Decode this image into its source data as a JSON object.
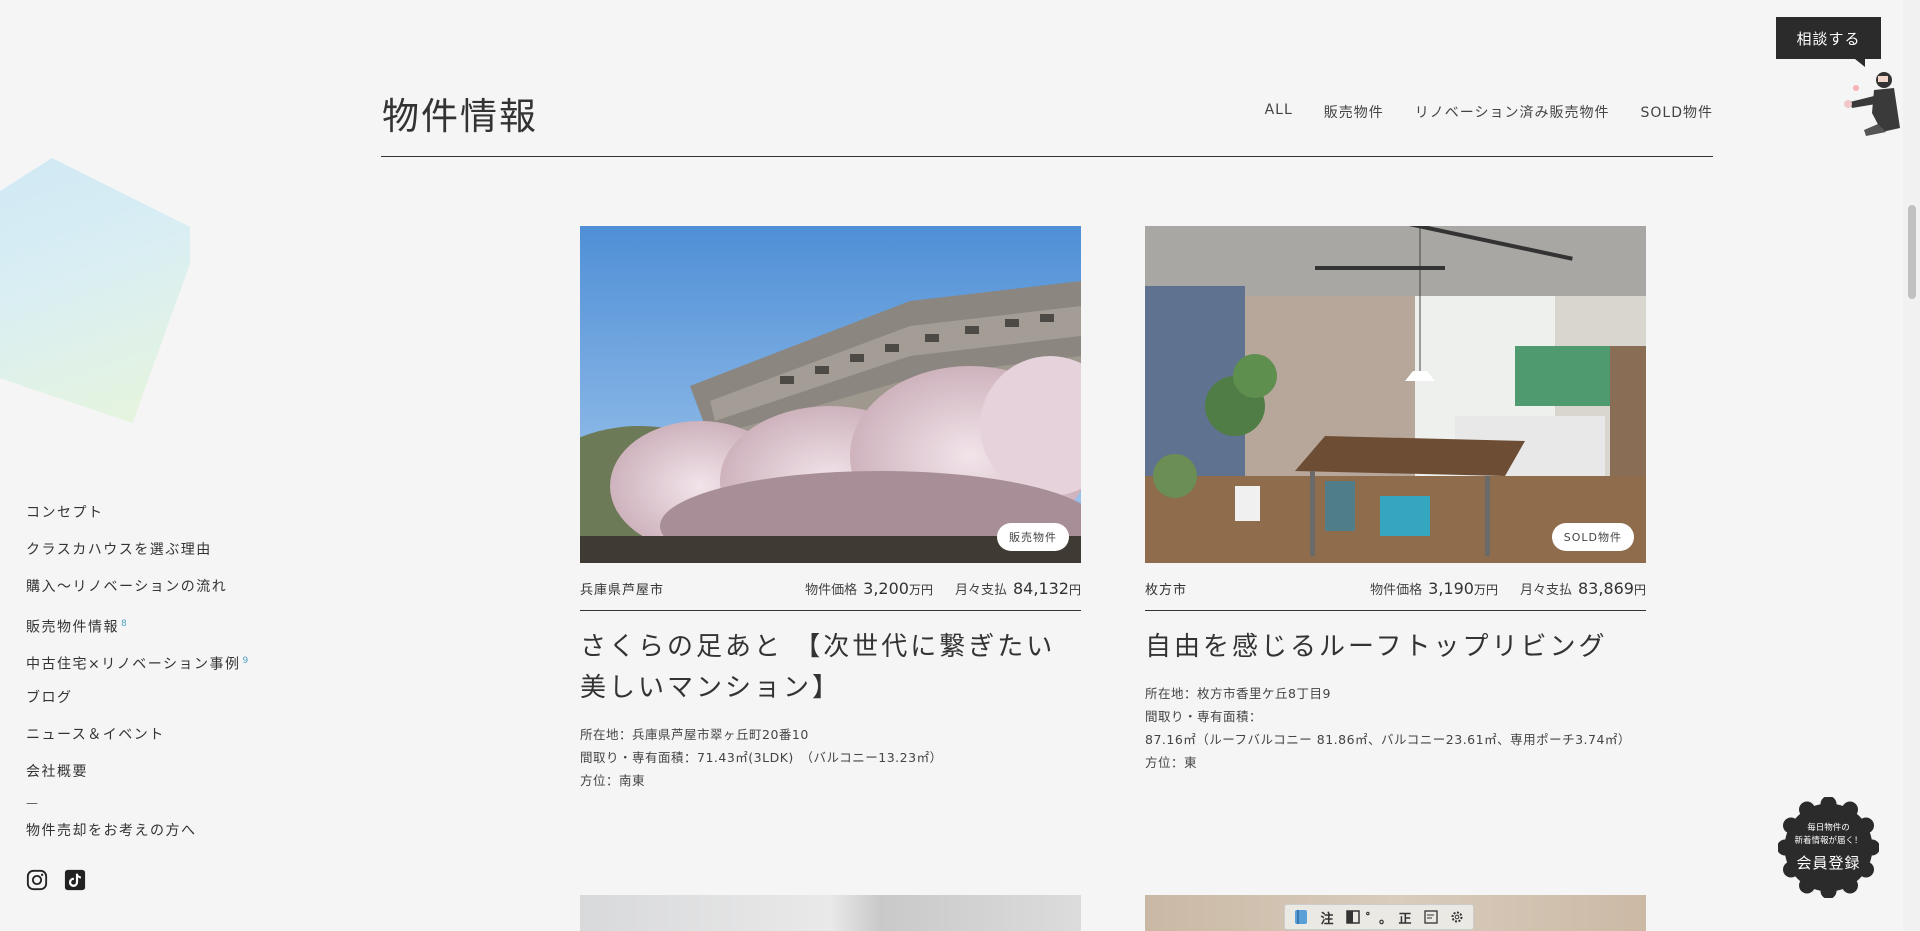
{
  "header": {
    "title": "物件情報",
    "filters": [
      "ALL",
      "販売物件",
      "リノベーション済み販売物件",
      "SOLD物件"
    ]
  },
  "sidebar": {
    "items": [
      {
        "label": "コンセプト"
      },
      {
        "label": "クラスカハウスを選ぶ理由"
      },
      {
        "label": "購入～リノベーションの流れ"
      },
      {
        "label": "販売物件情報",
        "count": "8"
      },
      {
        "label": "中古住宅×リノベーション事例",
        "count": "9"
      },
      {
        "label": "ブログ"
      },
      {
        "label": "ニュース＆イベント"
      },
      {
        "label": "会社概要"
      }
    ],
    "divider": "—",
    "sell_label": "物件売却をお考えの方へ",
    "social_icons": [
      "instagram-icon",
      "tiktok-icon"
    ]
  },
  "cards": [
    {
      "badge": "販売物件",
      "area": "兵庫県芦屋市",
      "price_label": "物件価格",
      "price": "3,200",
      "price_unit": "万円",
      "monthly_label": "月々支払",
      "monthly": "84,132",
      "monthly_unit": "円",
      "title": "さくらの足あと 【次世代に繋ぎたい美しいマンション】",
      "details": [
        "所在地：兵庫県芦屋市翠ヶ丘町20番10",
        "間取り・専有面積：71.43㎡(3LDK)　（バルコニー13.23㎡）",
        "方位：南東"
      ]
    },
    {
      "badge": "SOLD物件",
      "area": "枚方市",
      "price_label": "物件価格",
      "price": "3,190",
      "price_unit": "万円",
      "monthly_label": "月々支払",
      "monthly": "83,869",
      "monthly_unit": "円",
      "title": "自由を感じるルーフトップリビング",
      "details": [
        "所在地：枚方市香里ケ丘8丁目9",
        "間取り・専有面積：",
        "87.16㎡（ルーフバルコニー 81.86㎡、バルコニー23.61㎡、専用ポーチ3.74㎡）",
        "方位：東"
      ]
    }
  ],
  "floating": {
    "consult_label": "相談する",
    "register_line1": "毎日物件の",
    "register_line2": "新着情報が届く！",
    "register_main": "会員登録"
  },
  "toolbar": {
    "buttons": [
      "注",
      "゜。",
      "正"
    ]
  },
  "colors": {
    "background": "#f5f5f5",
    "text": "#333333",
    "dark": "#2b2b2b",
    "accent": "#4da0c4"
  }
}
